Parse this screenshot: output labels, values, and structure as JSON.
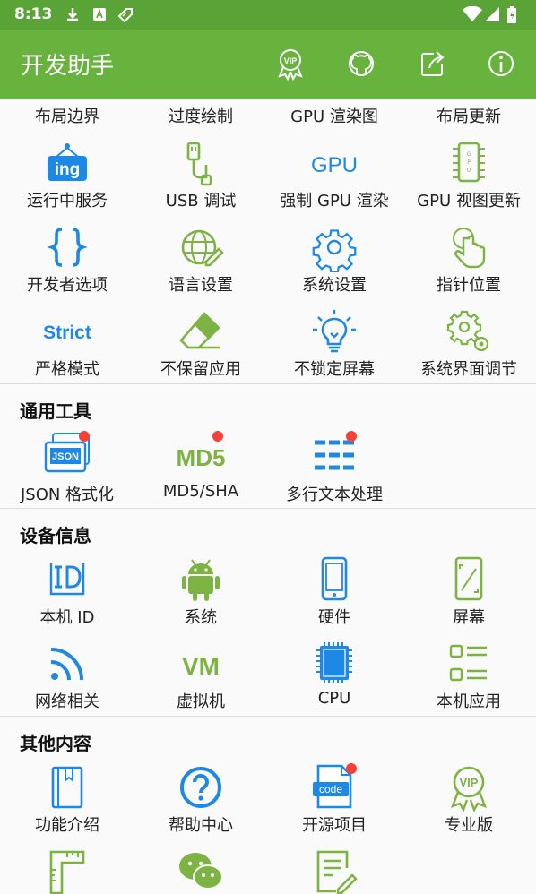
{
  "status": {
    "time": "8:13"
  },
  "appbar": {
    "title": "开发助手"
  },
  "top_labels": [
    "布局边界",
    "过度绘制",
    "GPU 渲染图",
    "布局更新"
  ],
  "dev_grid": [
    [
      "运行中服务",
      "USB 调试",
      "强制 GPU 渲染",
      "GPU 视图更新"
    ],
    [
      "开发者选项",
      "语言设置",
      "系统设置",
      "指针位置"
    ],
    [
      "严格模式",
      "不保留应用",
      "不锁定屏幕",
      "系统界面调节"
    ]
  ],
  "icon_texts": {
    "ing": "ing",
    "gpu": "GPU",
    "strict": "Strict",
    "json": "JSON",
    "md5": "MD5",
    "vm": "VM",
    "code": "code",
    "vip": "VIP"
  },
  "sections": {
    "tools": {
      "title": "通用工具",
      "items": [
        "JSON 格式化",
        "MD5/SHA",
        "多行文本处理"
      ]
    },
    "device": {
      "title": "设备信息",
      "items": [
        "本机 ID",
        "系统",
        "硬件",
        "屏幕",
        "网络相关",
        "虚拟机",
        "CPU",
        "本机应用"
      ]
    },
    "other": {
      "title": "其他内容",
      "items": [
        "功能介绍",
        "帮助中心",
        "开源项目",
        "专业版"
      ]
    }
  },
  "colors": {
    "appbar": "#67b33e",
    "statusbar": "#5aa437",
    "blue": "#1e88e5",
    "green": "#7cb342",
    "red_dot": "#f44336"
  }
}
